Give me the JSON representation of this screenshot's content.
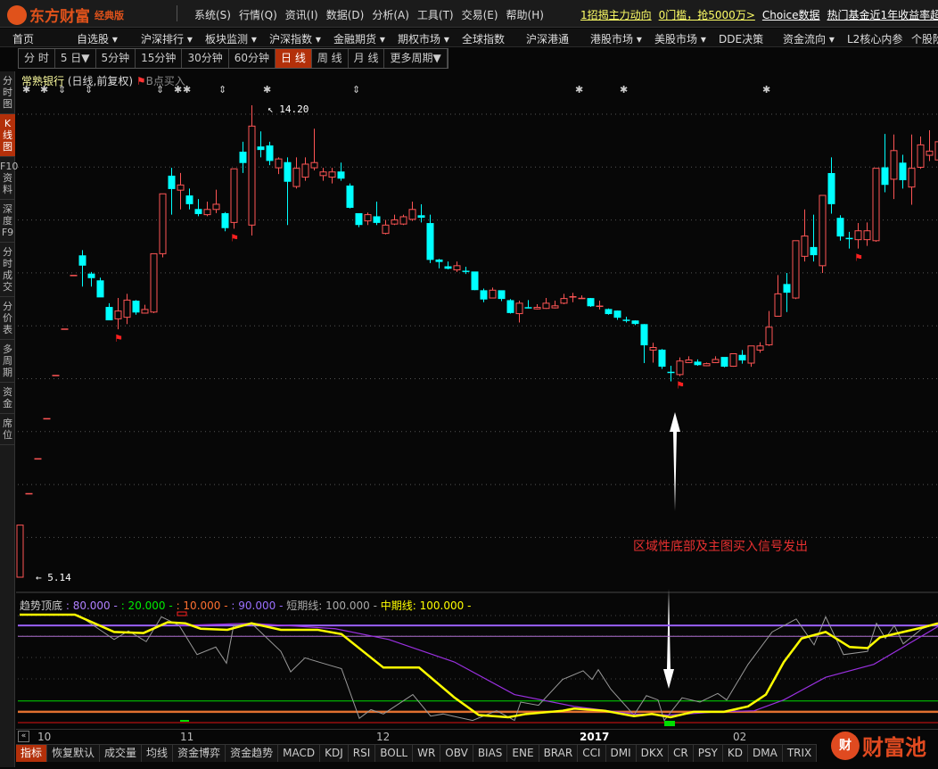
{
  "app": {
    "logo": "东方财富",
    "edition": "经典版"
  },
  "menus": [
    "系统(S)",
    "行情(Q)",
    "资讯(I)",
    "数据(D)",
    "分析(A)",
    "工具(T)",
    "交易(E)",
    "帮助(H)"
  ],
  "promos": [
    {
      "text": "1招揭主力动向",
      "color": "#ffff66"
    },
    {
      "text": "0门槛，抢5000万>",
      "color": "#ffff66"
    },
    {
      "text": "Choice数据",
      "color": "#ffffff"
    },
    {
      "text": "热门基金近1年收益率超60",
      "color": "#ffffff"
    }
  ],
  "nav": [
    "首页",
    "自选股 ▾",
    "沪深排行 ▾",
    "板块监测 ▾",
    "沪深指数 ▾",
    "金融期货 ▾",
    "期权市场 ▾",
    "全球指数",
    "沪深港通",
    "港股市场 ▾",
    "美股市场 ▾",
    "DDE决策",
    "资金流向 ▾",
    "L2核心内参",
    "个股阶"
  ],
  "periods": [
    {
      "label": "分 时"
    },
    {
      "label": "5 日▼"
    },
    {
      "label": "5分钟"
    },
    {
      "label": "15分钟"
    },
    {
      "label": "30分钟"
    },
    {
      "label": "60分钟"
    },
    {
      "label": "日 线",
      "active": true
    },
    {
      "label": "周 线"
    },
    {
      "label": "月 线"
    },
    {
      "label": "更多周期▼"
    }
  ],
  "sidebar": [
    {
      "label": "分时图"
    },
    {
      "label": "K线图",
      "active": true
    },
    {
      "label": "F10资料"
    },
    {
      "label": "深度F9"
    },
    {
      "label": "分时成交"
    },
    {
      "label": "分价表"
    },
    {
      "label": "多周期"
    },
    {
      "label": "资金"
    },
    {
      "label": "席位"
    }
  ],
  "stock": {
    "name": "常熟银行",
    "mode": "(日线,前复权)",
    "signal": "B点买入"
  },
  "price_labels": {
    "high": "14.20",
    "low": "5.14"
  },
  "annotation": "区域性底部及主图买入信号发出",
  "indicator_legend": {
    "name": "趋势顶底",
    "v1": ": 80.000",
    "v2": ": 20.000",
    "v3": ": 10.000",
    "v4": ": 90.000",
    "short_label": "短期线: 100.000",
    "mid_label": "中期线: 100.000",
    "dash": "-"
  },
  "xaxis": {
    "labels": [
      "10",
      "11",
      "12",
      "2017",
      "02"
    ],
    "scroll": "«"
  },
  "bottom_tabs": [
    "指标",
    "恢复默认",
    "成交量",
    "均线",
    "资金博弈",
    "资金趋势",
    "MACD",
    "KDJ",
    "RSI",
    "BOLL",
    "WR",
    "OBV",
    "BIAS",
    "ENE",
    "BRAR",
    "CCI",
    "DMI",
    "DKX",
    "CR",
    "PSY",
    "KD",
    "DMA",
    "TRIX"
  ],
  "watermark": {
    "badge": "财",
    "text": "财富池"
  },
  "colors": {
    "up": "#ff5555",
    "down": "#00ffff",
    "accent": "#b3300a",
    "yellow": "#ffff00",
    "purple": "#9a30e0",
    "gray": "#aaaaaa"
  },
  "chart_data": {
    "type": "candlestick",
    "price_range": [
      5.14,
      14.2
    ],
    "candles": [
      [
        5.14,
        6.14,
        6.14,
        5.14
      ],
      [
        6.75,
        6.75,
        6.75,
        6.75
      ],
      [
        7.42,
        7.42,
        7.42,
        7.42
      ],
      [
        8.19,
        8.19,
        8.19,
        8.19
      ],
      [
        9.02,
        9.02,
        9.02,
        9.02
      ],
      [
        9.91,
        9.91,
        9.91,
        9.91
      ],
      [
        10.94,
        10.94,
        10.94,
        10.94
      ],
      [
        11.31,
        11.13,
        11.42,
        10.72
      ],
      [
        10.96,
        10.89,
        11.0,
        10.72
      ],
      [
        10.83,
        10.52,
        10.89,
        10.52
      ],
      [
        10.32,
        10.08,
        10.4,
        10.08
      ],
      [
        10.1,
        10.25,
        10.5,
        9.9
      ],
      [
        10.13,
        10.46,
        10.58,
        10.0
      ],
      [
        10.44,
        10.23,
        10.46,
        10.18
      ],
      [
        10.21,
        10.28,
        10.37,
        10.2
      ],
      [
        10.23,
        11.35,
        11.35,
        10.21
      ],
      [
        11.35,
        12.5,
        12.5,
        11.28
      ],
      [
        12.84,
        12.6,
        13.0,
        12.1
      ],
      [
        12.57,
        12.67,
        12.9,
        12.2
      ],
      [
        12.46,
        12.31,
        12.6,
        12.2
      ],
      [
        12.2,
        12.12,
        12.4,
        12.07
      ],
      [
        12.1,
        12.2,
        12.35,
        12.07
      ],
      [
        12.2,
        12.3,
        12.58,
        12.13
      ],
      [
        12.12,
        11.85,
        12.15,
        11.78
      ],
      [
        11.95,
        12.98,
        12.98,
        11.83
      ],
      [
        13.3,
        13.1,
        13.5,
        12.9
      ],
      [
        11.9,
        13.8,
        14.2,
        11.7
      ],
      [
        13.4,
        13.35,
        13.7,
        13.2
      ],
      [
        13.42,
        13.14,
        13.5,
        13.05
      ],
      [
        13.0,
        13.17,
        13.2,
        12.88
      ],
      [
        13.1,
        12.74,
        13.2,
        11.9
      ],
      [
        12.64,
        12.99,
        13.2,
        12.6
      ],
      [
        12.82,
        13.07,
        13.2,
        12.75
      ],
      [
        13.0,
        13.1,
        13.75,
        12.95
      ],
      [
        12.85,
        12.92,
        13.0,
        12.75
      ],
      [
        12.82,
        12.92,
        13.0,
        12.7
      ],
      [
        12.92,
        12.8,
        13.1,
        12.75
      ],
      [
        12.65,
        12.24,
        12.7,
        12.22
      ],
      [
        12.12,
        11.91,
        12.12,
        11.86
      ],
      [
        11.98,
        12.1,
        12.14,
        11.9
      ],
      [
        12.06,
        11.95,
        12.35,
        11.9
      ],
      [
        11.74,
        11.9,
        12.0,
        11.72
      ],
      [
        11.92,
        12.0,
        12.1,
        11.9
      ],
      [
        11.92,
        12.06,
        12.1,
        11.9
      ],
      [
        12.01,
        12.2,
        12.35,
        11.98
      ],
      [
        12.08,
        12.05,
        12.3,
        11.95
      ],
      [
        11.93,
        11.24,
        12.1,
        11.17
      ],
      [
        11.23,
        11.2,
        11.25,
        11.07
      ],
      [
        11.1,
        11.07,
        11.2,
        11.05
      ],
      [
        11.04,
        11.12,
        11.2,
        11.0
      ],
      [
        11.02,
        11.02,
        11.1,
        10.96
      ],
      [
        11.0,
        10.66,
        11.0,
        10.65
      ],
      [
        10.64,
        10.48,
        10.68,
        10.42
      ],
      [
        10.5,
        10.65,
        10.7,
        10.5
      ],
      [
        10.64,
        10.49,
        10.64,
        10.44
      ],
      [
        10.45,
        10.22,
        10.48,
        10.2
      ],
      [
        10.2,
        10.4,
        10.45,
        10.03
      ],
      [
        10.32,
        10.32,
        10.46,
        10.3
      ],
      [
        10.29,
        10.32,
        10.38,
        10.28
      ],
      [
        10.3,
        10.4,
        10.5,
        10.29
      ],
      [
        10.31,
        10.35,
        10.45,
        10.3
      ],
      [
        10.4,
        10.49,
        10.58,
        10.38
      ],
      [
        10.53,
        10.53,
        10.6,
        10.42
      ],
      [
        10.49,
        10.5,
        10.55,
        10.49
      ],
      [
        10.49,
        10.35,
        10.5,
        10.33
      ],
      [
        10.35,
        10.35,
        10.45,
        10.28
      ],
      [
        10.28,
        10.2,
        10.3,
        10.18
      ],
      [
        10.25,
        10.13,
        10.26,
        10.08
      ],
      [
        10.08,
        10.08,
        10.14,
        10.03
      ],
      [
        10.06,
        10.01,
        10.07,
        9.98
      ],
      [
        9.99,
        9.6,
        10.0,
        9.25
      ],
      [
        9.5,
        9.55,
        9.64,
        9.26
      ],
      [
        9.5,
        9.19,
        9.52,
        9.14
      ],
      [
        9.08,
        9.08,
        9.2,
        8.9
      ],
      [
        9.03,
        9.29,
        9.36,
        9.0
      ],
      [
        9.26,
        9.31,
        9.38,
        9.25
      ],
      [
        9.27,
        9.22,
        9.32,
        9.2
      ],
      [
        9.2,
        9.24,
        9.26,
        9.19
      ],
      [
        9.26,
        9.32,
        9.38,
        9.25
      ],
      [
        9.36,
        9.19,
        9.36,
        9.17
      ],
      [
        9.19,
        9.43,
        9.43,
        9.18
      ],
      [
        9.4,
        9.31,
        9.5,
        9.24
      ],
      [
        9.25,
        9.58,
        9.58,
        9.18
      ],
      [
        9.5,
        9.58,
        9.65,
        9.45
      ],
      [
        9.6,
        9.94,
        10.25,
        9.58
      ],
      [
        10.15,
        10.58,
        10.94,
        10.14
      ],
      [
        10.76,
        10.61,
        10.98,
        10.23
      ],
      [
        10.5,
        11.6,
        11.6,
        10.48
      ],
      [
        11.3,
        11.69,
        12.2,
        11.2
      ],
      [
        11.47,
        11.33,
        12.1,
        11.2
      ],
      [
        11.12,
        12.47,
        12.47,
        10.98
      ],
      [
        12.89,
        12.31,
        13.2,
        12.12
      ],
      [
        12.03,
        11.69,
        12.09,
        11.6
      ],
      [
        11.65,
        11.65,
        11.77,
        11.45
      ],
      [
        11.62,
        11.79,
        11.94,
        11.45
      ],
      [
        11.62,
        11.79,
        11.95,
        11.5
      ],
      [
        11.6,
        12.99,
        12.99,
        11.58
      ],
      [
        13.0,
        12.68,
        13.65,
        12.53
      ],
      [
        12.78,
        13.33,
        13.64,
        12.4
      ],
      [
        13.09,
        12.77,
        13.25,
        12.6
      ],
      [
        12.63,
        12.99,
        13.64,
        12.29
      ],
      [
        13.01,
        13.44,
        13.6,
        12.98
      ],
      [
        13.24,
        13.32,
        13.72,
        13.13
      ],
      [
        13.15,
        13.5,
        13.8,
        13.1
      ]
    ],
    "buy_flags": [
      11,
      24,
      74,
      94
    ],
    "star_marks": [
      {
        "i": 0,
        "s": "✱"
      },
      {
        "i": 2,
        "s": "✱"
      },
      {
        "i": 4,
        "s": "⇕"
      },
      {
        "i": 7,
        "s": "⇕"
      },
      {
        "i": 15,
        "s": "⇕"
      },
      {
        "i": 17,
        "s": "✱"
      },
      {
        "i": 18,
        "s": "✱"
      },
      {
        "i": 22,
        "s": "⇕"
      },
      {
        "i": 27,
        "s": "✱"
      },
      {
        "i": 37,
        "s": "⇕"
      },
      {
        "i": 62,
        "s": "✱"
      },
      {
        "i": 67,
        "s": "✱"
      },
      {
        "i": 83,
        "s": "✱"
      }
    ],
    "x_label_index": [
      2,
      18,
      40,
      62.8,
      80
    ],
    "indicator": {
      "range": [
        0,
        100
      ],
      "levels": [
        {
          "v": 90,
          "color": "#9a60ff",
          "w": 2
        },
        {
          "v": 80,
          "color": "#b070d0",
          "w": 1
        },
        {
          "v": 20,
          "color": "#00dd00",
          "w": 1
        },
        {
          "v": 10,
          "color": "#e07030",
          "w": 2.5
        },
        {
          "v": 0,
          "color": "#dd1010",
          "w": 1
        }
      ],
      "mid": [
        [
          0,
          100
        ],
        [
          6.2,
          100
        ],
        [
          10.6,
          84
        ],
        [
          13.9,
          83
        ],
        [
          16.6,
          93
        ],
        [
          18.6,
          92
        ],
        [
          20.3,
          87
        ],
        [
          23.3,
          86
        ],
        [
          26,
          92
        ],
        [
          29.3,
          86
        ],
        [
          33.4,
          86
        ],
        [
          36.1,
          82
        ],
        [
          40.8,
          51
        ],
        [
          44.8,
          51
        ],
        [
          48.8,
          23
        ],
        [
          51.5,
          7
        ],
        [
          54.8,
          5
        ],
        [
          56.8,
          8
        ],
        [
          60.9,
          11
        ],
        [
          62.2,
          13
        ],
        [
          65.6,
          11
        ],
        [
          68.9,
          6
        ],
        [
          70.9,
          8
        ],
        [
          73,
          5
        ],
        [
          75.6,
          10
        ],
        [
          79,
          10
        ],
        [
          81.7,
          15
        ],
        [
          83.7,
          26
        ],
        [
          85.7,
          56
        ],
        [
          87.7,
          78
        ],
        [
          90.4,
          84
        ],
        [
          93.1,
          70
        ],
        [
          95.1,
          69
        ],
        [
          96.5,
          79
        ],
        [
          99.1,
          84
        ],
        [
          101.2,
          88
        ],
        [
          103,
          92
        ]
      ],
      "short": [
        [
          6.5,
          100
        ],
        [
          10.6,
          77
        ],
        [
          12.2,
          85
        ],
        [
          14.2,
          75
        ],
        [
          15.9,
          98
        ],
        [
          17.9,
          90
        ],
        [
          19.9,
          63
        ],
        [
          22,
          70
        ],
        [
          23.2,
          55
        ],
        [
          24,
          90
        ],
        [
          26,
          92
        ],
        [
          29.3,
          66
        ],
        [
          30.4,
          47
        ],
        [
          32,
          60
        ],
        [
          34,
          55
        ],
        [
          36.1,
          50
        ],
        [
          38.1,
          4
        ],
        [
          39.4,
          12
        ],
        [
          40.8,
          8
        ],
        [
          44.1,
          26
        ],
        [
          46.1,
          6
        ],
        [
          47.5,
          8
        ],
        [
          50.8,
          2
        ],
        [
          53.5,
          11
        ],
        [
          55.5,
          2
        ],
        [
          56.2,
          19
        ],
        [
          58.2,
          16
        ],
        [
          60.9,
          40
        ],
        [
          63.2,
          48
        ],
        [
          64.2,
          40
        ],
        [
          64.9,
          49
        ],
        [
          66.3,
          31
        ],
        [
          68.9,
          7
        ],
        [
          70.3,
          25
        ],
        [
          71.6,
          21
        ],
        [
          72.3,
          2
        ],
        [
          74.3,
          23
        ],
        [
          76.3,
          19
        ],
        [
          78.3,
          27
        ],
        [
          79.3,
          21
        ],
        [
          81.7,
          54
        ],
        [
          84.4,
          84
        ],
        [
          87.1,
          96
        ],
        [
          89.1,
          72
        ],
        [
          90.4,
          98
        ],
        [
          92.4,
          63
        ],
        [
          95.1,
          66
        ],
        [
          96.1,
          92
        ],
        [
          97.1,
          78
        ],
        [
          98.1,
          90
        ],
        [
          99.1,
          73
        ],
        [
          101.2,
          87
        ],
        [
          103,
          92
        ]
      ],
      "long": [
        [
          17.9,
          90
        ],
        [
          26,
          92
        ],
        [
          35.4,
          87
        ],
        [
          41.4,
          77
        ],
        [
          48.8,
          56
        ],
        [
          55.5,
          26
        ],
        [
          62.2,
          15
        ],
        [
          68.9,
          8
        ],
        [
          73,
          7
        ],
        [
          78.3,
          10
        ],
        [
          82.4,
          11
        ],
        [
          85.7,
          21
        ],
        [
          90.4,
          42
        ],
        [
          95.8,
          54
        ],
        [
          103,
          89
        ]
      ]
    }
  }
}
